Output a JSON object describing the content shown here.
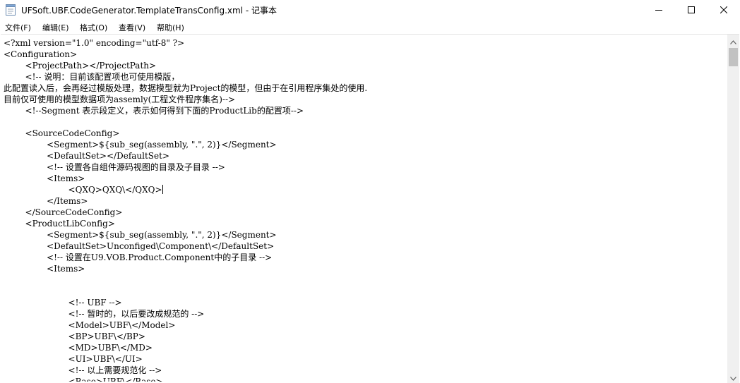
{
  "window": {
    "title": "UFSoft.UBF.CodeGenerator.TemplateTransConfig.xml - 记事本",
    "app_icon": "notepad-icon",
    "controls": [
      "minimize-icon",
      "maximize-icon",
      "close-icon"
    ]
  },
  "menu": {
    "items": [
      "文件(F)",
      "编辑(E)",
      "格式(O)",
      "查看(V)",
      "帮助(H)"
    ]
  },
  "editor": {
    "lines": [
      "<?xml version=\"1.0\" encoding=\"utf-8\" ?>",
      "<Configuration>",
      "        <ProjectPath></ProjectPath>",
      "        <!-- 说明：目前该配置项也可使用模版，",
      "此配置读入后，会再经过模版处理，数据模型就为Project的模型，但由于在引用程序集处的使用.",
      "目前仅可使用的模型数据项为assemly(工程文件程序集名)-->",
      "        <!--Segment 表示段定义，表示如何得到下面的ProductLib的配置项-->",
      "",
      "        <SourceCodeConfig>",
      "                <Segment>${sub_seg(assembly, \".\", 2)}</Segment>",
      "                <DefaultSet></DefaultSet>",
      "                <!-- 设置各自组件源码视图的目录及子目录 -->",
      "                <Items>",
      "                        <QXQ>QXQ\\</QXQ>",
      "                </Items>",
      "        </SourceCodeConfig>",
      "        <ProductLibConfig>",
      "                <Segment>${sub_seg(assembly, \".\", 2)}</Segment>",
      "                <DefaultSet>Unconfiged\\Component\\</DefaultSet>",
      "                <!-- 设置在U9.VOB.Product.Component中的子目录 -->",
      "                <Items>",
      "",
      "",
      "                        <!-- UBF -->",
      "                        <!-- 暂时的，以后要改成规范的 -->",
      "                        <Model>UBF\\</Model>",
      "                        <BP>UBF\\</BP>",
      "                        <MD>UBF\\</MD>",
      "                        <UI>UBF\\</UI>",
      "                        <!-- 以上需要规范化 -->",
      "                        <Base>UBF\\</Base>"
    ]
  },
  "scrollbar": {
    "up_icon": "scroll-up-arrow-icon",
    "down_icon": "scroll-down-arrow-icon"
  }
}
